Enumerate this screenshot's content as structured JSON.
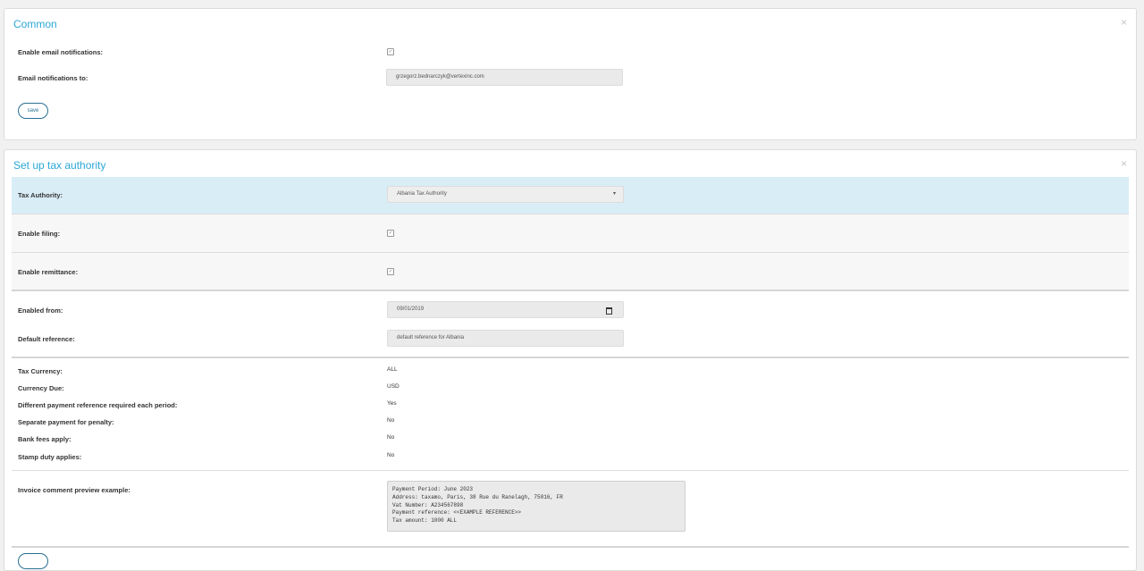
{
  "common": {
    "title": "Common",
    "close_icon": "×",
    "enable_email_label": "Enable email notifications:",
    "enable_email_checked": true,
    "email_to_label": "Email notifications to:",
    "email_to_value": "grzegorz.bednarczyk@vertexinc.com",
    "save_label": "save"
  },
  "tax": {
    "title": "Set up tax authority",
    "close_icon": "×",
    "authority_label": "Tax Authority:",
    "authority_value": "Albania Tax Authority",
    "enable_filing_label": "Enable filing:",
    "enable_filing_checked": true,
    "enable_remittance_label": "Enable remittance:",
    "enable_remittance_checked": true,
    "enabled_from_label": "Enabled from:",
    "enabled_from_value": "09/01/2019",
    "default_reference_label": "Default reference:",
    "default_reference_value": "default reference for Albania",
    "details": [
      {
        "label": "Tax Currency:",
        "value": "ALL"
      },
      {
        "label": "Currency Due:",
        "value": "USD"
      },
      {
        "label": "Different payment reference required each period:",
        "value": "Yes"
      },
      {
        "label": "Separate payment for penalty:",
        "value": "No"
      },
      {
        "label": "Bank fees apply:",
        "value": "No"
      },
      {
        "label": "Stamp duty applies:",
        "value": "No"
      }
    ],
    "invoice_label": "Invoice comment preview example:",
    "invoice_preview": "Payment Period: June 2023\nAddress: taxamo, Paris, 38 Rue du Ranelagh, 75016, FR\nVat Number: A234567898\nPayment reference: <<EXAMPLE REFERENCE>>\nTax amount: 1000 ALL"
  },
  "icons": {
    "checkbox": "checkbox-icon",
    "select_caret": "caret-down-icon",
    "calendar": "calendar-icon",
    "close": "close-icon"
  }
}
